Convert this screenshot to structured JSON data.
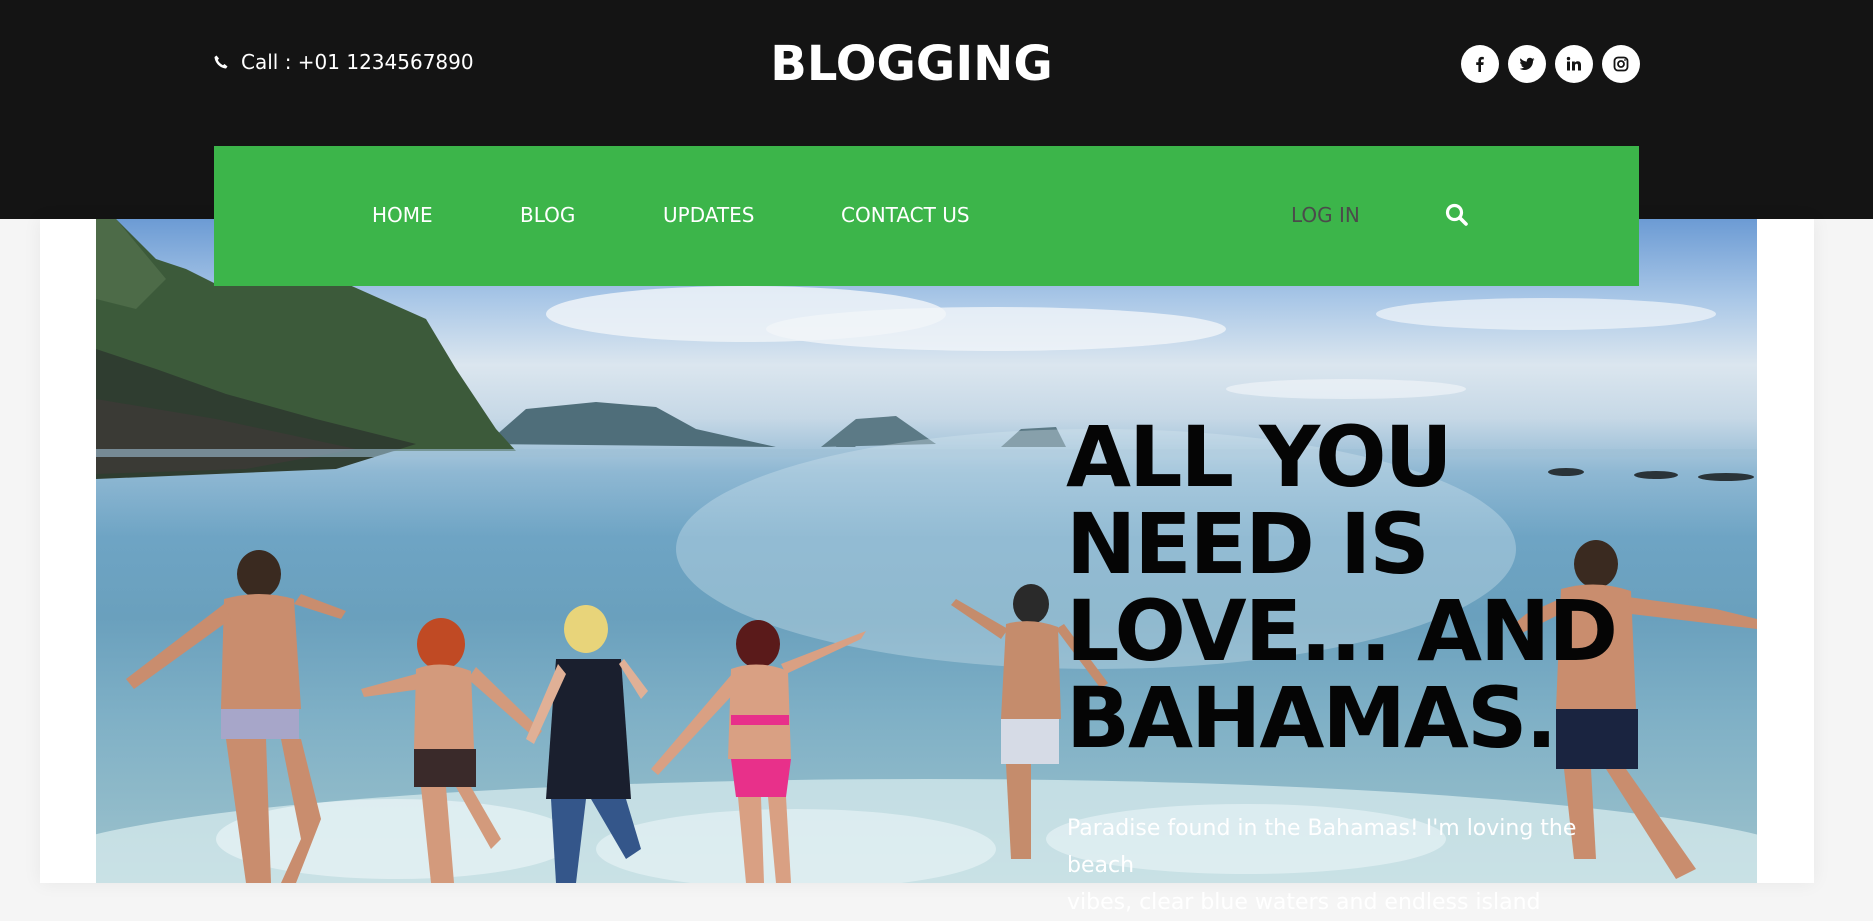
{
  "header": {
    "call_text": "Call : +01 1234567890",
    "logo": "BLOGGING",
    "social_icons": [
      "facebook-icon",
      "twitter-icon",
      "linkedin-icon",
      "instagram-icon"
    ]
  },
  "nav": {
    "items": [
      "HOME",
      "BLOG",
      "UPDATES",
      "CONTACT US"
    ],
    "login": "LOG IN",
    "search_icon": "search-icon"
  },
  "hero": {
    "headline_lines": [
      "ALL YOU",
      "NEED IS",
      "LOVE... AND",
      "BAHAMAS."
    ],
    "lead_lines": [
      "Paradise found in the Bahamas! I'm loving the beach",
      "vibes, clear blue waters and endless island"
    ]
  },
  "colors": {
    "topbar": "#141414",
    "nav_green": "#3cb54a",
    "login_text": "#4b4b4b",
    "headline": "#050505"
  }
}
